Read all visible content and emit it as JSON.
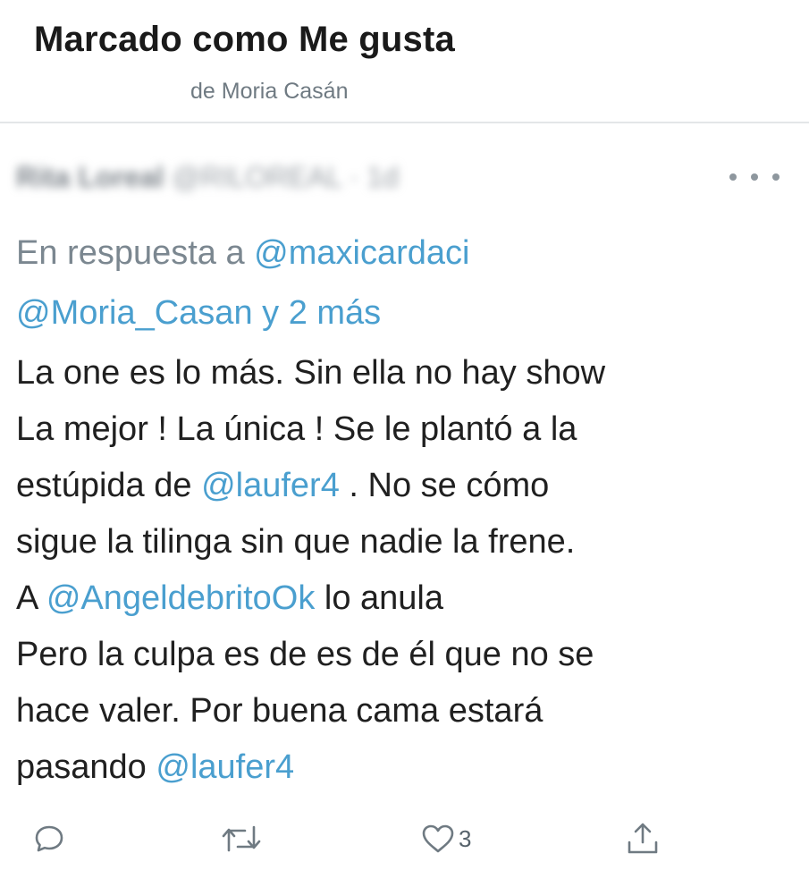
{
  "header": {
    "title": "Marcado como Me gusta",
    "subtitle": "de Moria Casán"
  },
  "tweet": {
    "author_name": "Rita Loreal",
    "author_handle": "@RILOREAL",
    "time": "· 1d",
    "reply_prefix": "En respuesta a",
    "reply_to_1": "@maxicardaci",
    "reply_to_2": "@Moria_Casan",
    "reply_more": "y 2 más",
    "line1": "La one es lo más. Sin ella no hay show",
    "line2": "La mejor ! La única ! Se le plantó a la",
    "line3_a": "estúpida de",
    "line3_mention": "@laufer4",
    "line3_b": ". No se cómo",
    "line4": "sigue la tilinga sin que nadie la frene.",
    "line5_a": "A",
    "line5_mention": "@AngeldebritoOk",
    "line5_b": "lo anula",
    "line6": "Pero la culpa es de es de él que no se",
    "line7": "hace valer. Por buena cama estará",
    "line8_a": "pasando",
    "line8_mention": "@laufer4",
    "likes": "3"
  },
  "icons": {
    "more": "more-horizontal-icon",
    "reply": "reply-bubble-icon",
    "retweet": "retweet-icon",
    "like": "heart-icon",
    "share": "share-icon"
  },
  "colors": {
    "mention": "#4a9fcf",
    "muted": "#7b8790",
    "text": "#202020"
  }
}
